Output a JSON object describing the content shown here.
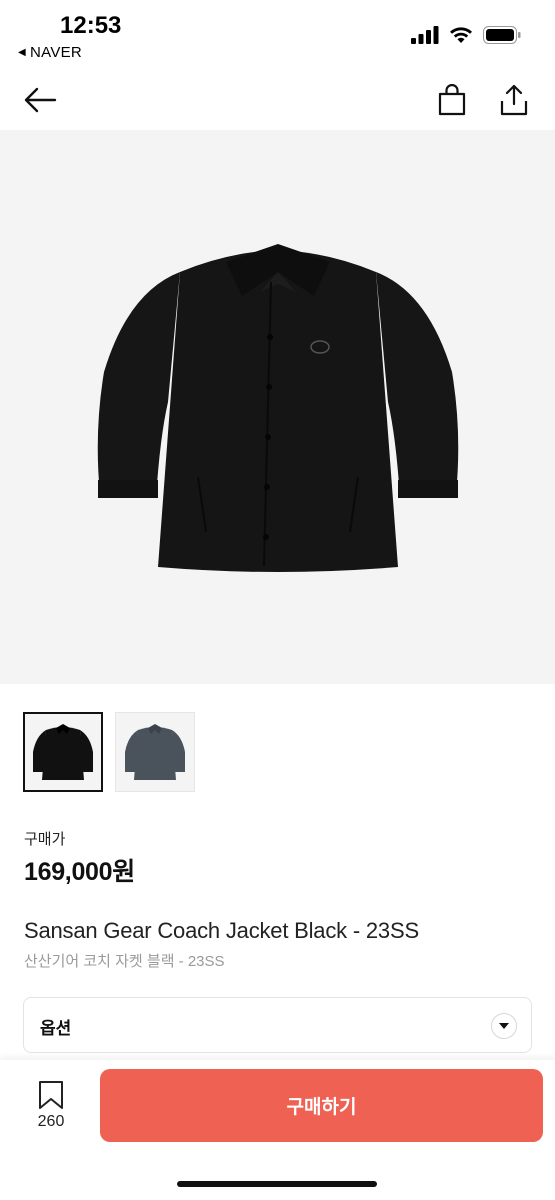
{
  "status_bar": {
    "time": "12:53",
    "back_app": "NAVER"
  },
  "nav": {
    "icons": [
      "back-arrow-icon",
      "shopping-bag-icon",
      "share-icon"
    ]
  },
  "product": {
    "price_label": "구매가",
    "price": "169,000원",
    "title_en": "Sansan Gear Coach Jacket Black - 23SS",
    "title_ko": "산산기어 코치 자켓 블랙 - 23SS",
    "thumbnail_colors": [
      "#111111",
      "#4a525c"
    ],
    "main_jacket_color": "#141414"
  },
  "option": {
    "label": "옵션"
  },
  "bottom": {
    "bookmark_count": "260",
    "buy_label": "구매하기",
    "buy_color": "#ef6253"
  }
}
